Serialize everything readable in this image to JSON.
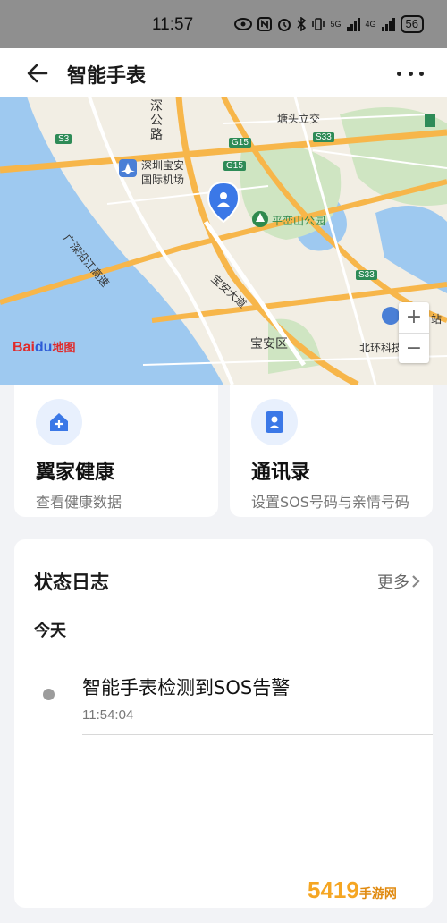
{
  "status_bar": {
    "time": "11:57",
    "network_5g": "5G",
    "network_4g": "4G",
    "battery": "56"
  },
  "header": {
    "title": "智能手表"
  },
  "map": {
    "labels": {
      "shengong": "深",
      "gonglu": "公",
      "lu": "路",
      "tangxia": "塘头立交",
      "airport_1": "深圳宝安",
      "airport_2": "国际机场",
      "expressway": "广深沿江高速",
      "park": "平峦山公园",
      "avenue": "宝安大道",
      "district": "宝安区",
      "beihuan": "北环科技",
      "zhan": "站"
    },
    "road_badges": {
      "s3_left": "S3",
      "g15_top": "G15",
      "g15_mid": "G15",
      "s33_top": "S33",
      "s33_right": "S33"
    },
    "zoom_in": "+",
    "zoom_out": "−",
    "logo_text_1": "Bai",
    "logo_text_2": "du",
    "logo_text_3": "地图"
  },
  "cards": [
    {
      "title": "翼家健康",
      "desc": "查看健康数据",
      "icon": "home-health-icon"
    },
    {
      "title": "通讯录",
      "desc": "设置SOS号码与亲情号码",
      "icon": "contacts-icon"
    }
  ],
  "status_log": {
    "title": "状态日志",
    "more_label": "更多",
    "day": "今天",
    "events": [
      {
        "text": "智能手表检测到SOS告警",
        "time": "11:54:04"
      }
    ]
  },
  "watermark": {
    "main": "5419",
    "sub": "手游网"
  },
  "colors": {
    "accent": "#3b78e7",
    "map_water": "#9ec9f0",
    "map_land": "#f2eee4",
    "map_green": "#cfe5c2",
    "highway": "#f7b64a"
  }
}
